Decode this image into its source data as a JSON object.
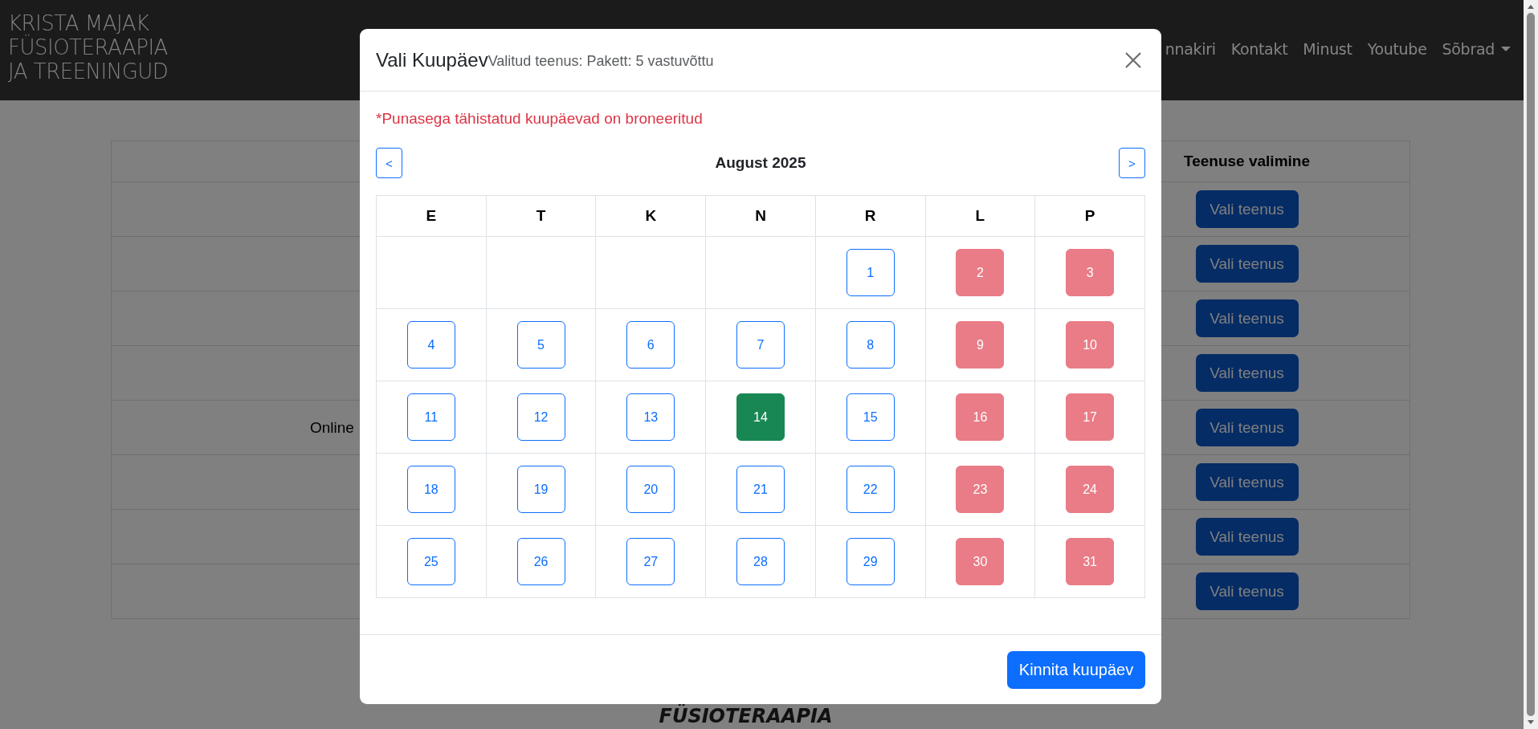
{
  "navbar": {
    "brand_lines": [
      "KRISTA MAJAK",
      "FÜSIOTERAAPIA",
      "JA TREENINGUD"
    ],
    "links": [
      {
        "label": "nnakiri",
        "dropdown": false
      },
      {
        "label": "Kontakt",
        "dropdown": false
      },
      {
        "label": "Minust",
        "dropdown": false
      },
      {
        "label": "Youtube",
        "dropdown": false
      },
      {
        "label": "Sõbrad",
        "dropdown": true
      }
    ]
  },
  "services_table": {
    "header": "Teenuse valimine",
    "rows": [
      {
        "button": "Vali teenus"
      },
      {
        "button": "Vali teenus"
      },
      {
        "button": "Vali teenus"
      },
      {
        "button": "Vali teenus"
      },
      {
        "text": "Online",
        "button": "Vali teenus"
      },
      {
        "button": "Vali teenus"
      },
      {
        "button": "Vali teenus"
      },
      {
        "button": "Vali teenus"
      }
    ]
  },
  "page_heading": "FÜSIOTERAAPIA",
  "modal": {
    "title": "Vali Kuupäev",
    "subtitle": "Valitud teenus: Pakett: 5 vastuvõttu",
    "notice": "*Punasega tähistatud kuupäevad on broneeritud",
    "prev": "<",
    "next": ">",
    "month": "August 2025",
    "weekdays": [
      "E",
      "T",
      "K",
      "N",
      "R",
      "L",
      "P"
    ],
    "weeks": [
      [
        {
          "kind": "empty"
        },
        {
          "kind": "empty"
        },
        {
          "kind": "empty"
        },
        {
          "kind": "empty"
        },
        {
          "kind": "day",
          "label": "1",
          "booked": false,
          "selected": false
        },
        {
          "kind": "day",
          "label": "2",
          "booked": true,
          "selected": false
        },
        {
          "kind": "day",
          "label": "3",
          "booked": true,
          "selected": false
        }
      ],
      [
        {
          "kind": "day",
          "label": "4",
          "booked": false,
          "selected": false
        },
        {
          "kind": "day",
          "label": "5",
          "booked": false,
          "selected": false
        },
        {
          "kind": "day",
          "label": "6",
          "booked": false,
          "selected": false
        },
        {
          "kind": "day",
          "label": "7",
          "booked": false,
          "selected": false
        },
        {
          "kind": "day",
          "label": "8",
          "booked": false,
          "selected": false
        },
        {
          "kind": "day",
          "label": "9",
          "booked": true,
          "selected": false
        },
        {
          "kind": "day",
          "label": "10",
          "booked": true,
          "selected": false
        }
      ],
      [
        {
          "kind": "day",
          "label": "11",
          "booked": false,
          "selected": false
        },
        {
          "kind": "day",
          "label": "12",
          "booked": false,
          "selected": false
        },
        {
          "kind": "day",
          "label": "13",
          "booked": false,
          "selected": false
        },
        {
          "kind": "day",
          "label": "14",
          "booked": false,
          "selected": true
        },
        {
          "kind": "day",
          "label": "15",
          "booked": false,
          "selected": false
        },
        {
          "kind": "day",
          "label": "16",
          "booked": true,
          "selected": false
        },
        {
          "kind": "day",
          "label": "17",
          "booked": true,
          "selected": false
        }
      ],
      [
        {
          "kind": "day",
          "label": "18",
          "booked": false,
          "selected": false
        },
        {
          "kind": "day",
          "label": "19",
          "booked": false,
          "selected": false
        },
        {
          "kind": "day",
          "label": "20",
          "booked": false,
          "selected": false
        },
        {
          "kind": "day",
          "label": "21",
          "booked": false,
          "selected": false
        },
        {
          "kind": "day",
          "label": "22",
          "booked": false,
          "selected": false
        },
        {
          "kind": "day",
          "label": "23",
          "booked": true,
          "selected": false
        },
        {
          "kind": "day",
          "label": "24",
          "booked": true,
          "selected": false
        }
      ],
      [
        {
          "kind": "day",
          "label": "25",
          "booked": false,
          "selected": false
        },
        {
          "kind": "day",
          "label": "26",
          "booked": false,
          "selected": false
        },
        {
          "kind": "day",
          "label": "27",
          "booked": false,
          "selected": false
        },
        {
          "kind": "day",
          "label": "28",
          "booked": false,
          "selected": false
        },
        {
          "kind": "day",
          "label": "29",
          "booked": false,
          "selected": false
        },
        {
          "kind": "day",
          "label": "30",
          "booked": true,
          "selected": false
        },
        {
          "kind": "day",
          "label": "31",
          "booked": true,
          "selected": false
        }
      ]
    ],
    "confirm_button": "Kinnita kuupäev"
  }
}
